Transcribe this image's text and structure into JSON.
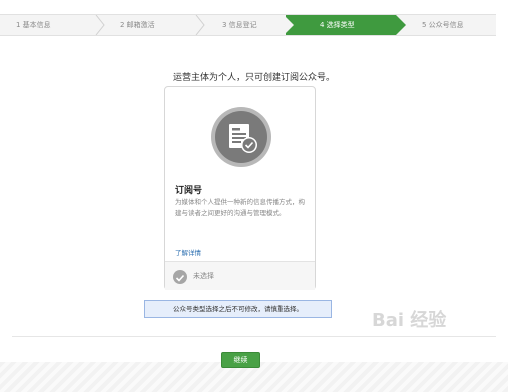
{
  "steps": [
    {
      "label": "1 基本信息",
      "state": "done"
    },
    {
      "label": "2 邮箱激活",
      "state": "done"
    },
    {
      "label": "3 信息登记",
      "state": "done"
    },
    {
      "label": "4 选择类型",
      "state": "active"
    },
    {
      "label": "5 公众号信息",
      "state": "todo"
    }
  ],
  "headline": "运营主体为个人，只可创建订阅公众号。",
  "card": {
    "icon": "document-check-icon",
    "title": "订阅号",
    "description": "为媒体和个人提供一种新的信息传播方式，构建与读者之间更好的沟通与管理模式。",
    "link": "了解详情",
    "status": "未选择"
  },
  "notice": "公众号类型选择之后不可修改，请慎重选择。",
  "button": "继续",
  "watermark": "Bai 经验",
  "colors": {
    "active": "#3f9a3f",
    "button": "#49a146",
    "link": "#2a6eb0"
  }
}
